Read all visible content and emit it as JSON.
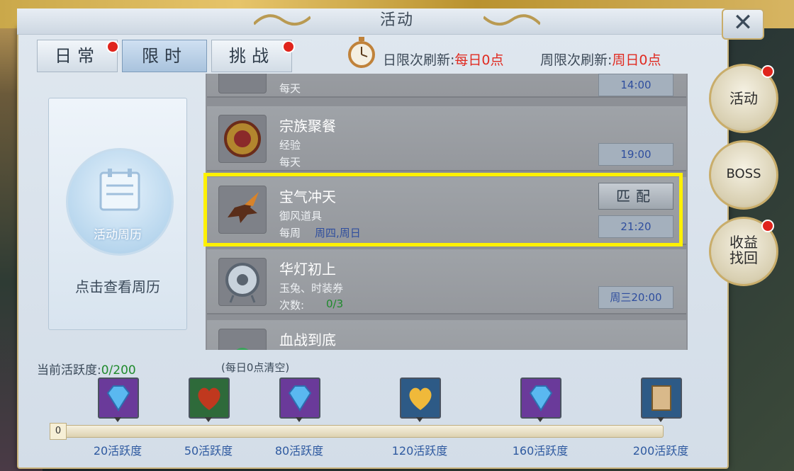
{
  "window": {
    "title": "活动"
  },
  "tabs": [
    {
      "label": "日常",
      "badge": true
    },
    {
      "label": "限时",
      "active": true
    },
    {
      "label": "挑战",
      "badge": true
    }
  ],
  "refresh": {
    "daily_label": "日限次刷新:",
    "daily_value": "每日0点",
    "weekly_label": "周限次刷新:",
    "weekly_value": "周日0点"
  },
  "calendar": {
    "icon_label": "活动周历",
    "caption": "点击查看周历"
  },
  "activities": [
    {
      "name": "",
      "reward": "",
      "freq": "每天",
      "time": "14:00"
    },
    {
      "name": "宗族聚餐",
      "reward": "经验",
      "freq": "每天",
      "time": "19:00"
    },
    {
      "name": "宝气冲天",
      "reward": "御风道具",
      "freq": "每周",
      "days": "周四,周日",
      "time": "21:20",
      "button": "匹配",
      "highlighted": true
    },
    {
      "name": "华灯初上",
      "reward": "玉兔、时装券",
      "freq": "次数:",
      "count": "0/3",
      "time": "周三20:00"
    },
    {
      "name": "血战到底",
      "reward": "",
      "freq": "",
      "time": ""
    }
  ],
  "side_buttons": [
    {
      "label": "活动",
      "badge": true
    },
    {
      "label": "BOSS",
      "badge": false
    },
    {
      "label": "收益找回",
      "badge": true
    }
  ],
  "progress": {
    "current_label": "当前活跃度:",
    "current_value": "0/200",
    "clear_note": "(每日0点清空)",
    "start_value": "0",
    "current": 0,
    "max": 200,
    "milestones": [
      {
        "label": "20活跃度",
        "icon": "blue-diamond-icon",
        "color": "#6a3a9a"
      },
      {
        "label": "50活跃度",
        "icon": "red-heart-icon",
        "color": "#2e6a3a"
      },
      {
        "label": "80活跃度",
        "icon": "blue-diamond-icon",
        "color": "#6a3a9a"
      },
      {
        "label": "120活跃度",
        "icon": "gold-heart-icon",
        "color": "#2d5a86"
      },
      {
        "label": "160活跃度",
        "icon": "blue-diamond-icon",
        "color": "#6a3a9a"
      },
      {
        "label": "200活跃度",
        "icon": "scroll-icon",
        "color": "#2d5a86"
      }
    ]
  },
  "colors": {
    "highlight": "#fff100",
    "badge": "#e0241c",
    "accent_red": "#e02a20"
  }
}
